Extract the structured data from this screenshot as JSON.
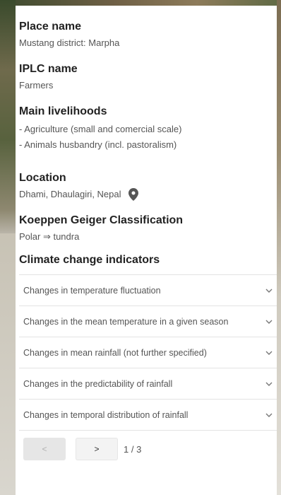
{
  "place": {
    "label": "Place name",
    "value": "Mustang district: Marpha"
  },
  "iplc": {
    "label": "IPLC name",
    "value": "Farmers"
  },
  "livelihoods": {
    "label": "Main livelihoods",
    "items": [
      "- Agriculture (small and comercial scale)",
      "- Animals husbandry (incl. pastoralism)"
    ]
  },
  "location": {
    "label": "Location",
    "value": "Dhami, Dhaulagiri, Nepal",
    "icon": "map-pin-icon"
  },
  "koeppen": {
    "label": "Koeppen Geiger Classification",
    "value": "Polar ⇒ tundra"
  },
  "climate": {
    "label": "Climate change indicators",
    "items": [
      "Changes in temperature fluctuation",
      "Changes in the mean temperature in a given season",
      "Changes in mean rainfall (not further specified)",
      "Changes in the predictability of rainfall",
      "Changes in temporal distribution of rainfall"
    ]
  },
  "pager": {
    "prev": "<",
    "next": ">",
    "status": "1 / 3"
  }
}
